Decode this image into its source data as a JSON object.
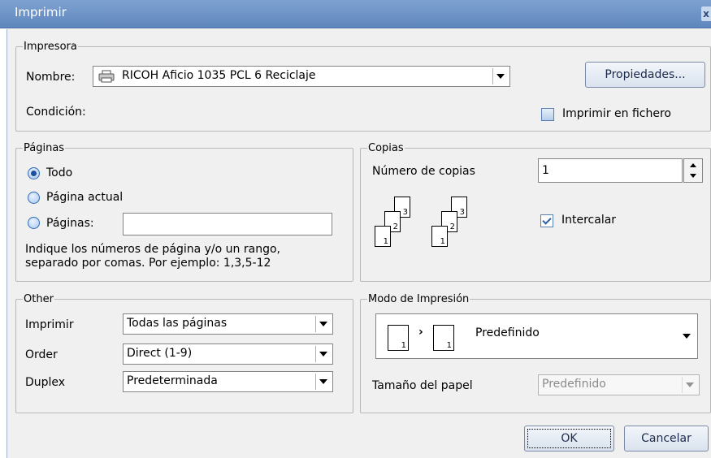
{
  "window": {
    "title": "Imprimir",
    "close_glyph": "x"
  },
  "printer": {
    "legend": "Impresora",
    "name_label": "Nombre:",
    "name_value": "RICOH Aficio 1035 PCL 6 Reciclaje",
    "properties_button": "Propiedades...",
    "status_label": "Condición:",
    "print_to_file_label": "Imprimir en fichero",
    "print_to_file_checked": false
  },
  "pages": {
    "legend": "Páginas",
    "options": [
      "Todo",
      "Página actual",
      "Páginas:"
    ],
    "selected_index": 0,
    "range_value": "",
    "hint_line1": "Indique los números de página y/o un rango,",
    "hint_line2": "separado por comas. Por ejemplo: 1,3,5-12"
  },
  "copies": {
    "legend": "Copias",
    "count_label": "Número de copias",
    "count_value": "1",
    "collate_label": "Intercalar",
    "collate_checked": true,
    "collate_pages": [
      "1",
      "2",
      "3"
    ]
  },
  "other": {
    "legend": "Other",
    "rows": [
      {
        "label": "Imprimir",
        "value": "Todas las páginas"
      },
      {
        "label": "Order",
        "value": "Direct (1-9)"
      },
      {
        "label": "Duplex",
        "value": "Predeterminada"
      }
    ]
  },
  "print_mode": {
    "legend": "Modo de Impresión",
    "mode_value": "Predefinido",
    "mode_pages": [
      "1",
      "1"
    ],
    "paper_size_label": "Tamaño del papel",
    "paper_size_value": "Predefinido"
  },
  "footer": {
    "ok_label": "OK",
    "cancel_label": "Cancelar"
  }
}
